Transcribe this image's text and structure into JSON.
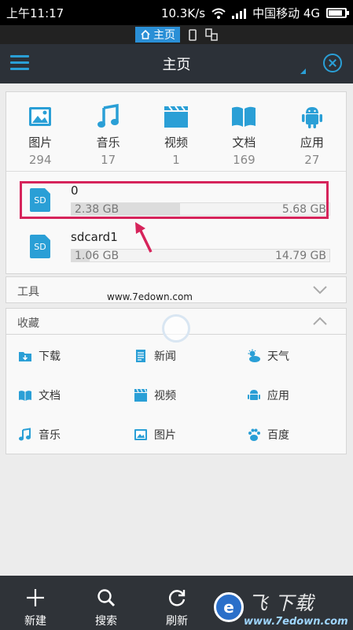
{
  "status_bar": {
    "time": "上午11:17",
    "speed": "10.3K/s",
    "carrier": "中国移动 4G"
  },
  "subbar": {
    "home_tab": "主页"
  },
  "header": {
    "title": "主页"
  },
  "categories": [
    {
      "label": "图片",
      "count": "294",
      "icon": "image-icon"
    },
    {
      "label": "音乐",
      "count": "17",
      "icon": "music-icon"
    },
    {
      "label": "视频",
      "count": "1",
      "icon": "video-icon"
    },
    {
      "label": "文档",
      "count": "169",
      "icon": "book-icon"
    },
    {
      "label": "应用",
      "count": "27",
      "icon": "android-icon"
    }
  ],
  "storage": [
    {
      "icon_label": "SD",
      "name": "0",
      "used": "2.38 GB",
      "total": "5.68 GB",
      "used_fraction": 0.42
    },
    {
      "icon_label": "SD",
      "name": "sdcard1",
      "used": "1.06 GB",
      "total": "14.79 GB",
      "used_fraction": 0.07
    }
  ],
  "tools": {
    "title": "工具"
  },
  "favorites": {
    "title": "收藏",
    "items": [
      {
        "label": "下载",
        "icon": "download-folder-icon"
      },
      {
        "label": "新闻",
        "icon": "news-icon"
      },
      {
        "label": "天气",
        "icon": "weather-icon"
      },
      {
        "label": "文档",
        "icon": "document-folder-icon"
      },
      {
        "label": "视频",
        "icon": "video-folder-icon"
      },
      {
        "label": "应用",
        "icon": "app-folder-icon"
      },
      {
        "label": "音乐",
        "icon": "music-folder-icon"
      },
      {
        "label": "图片",
        "icon": "picture-folder-icon"
      },
      {
        "label": "百度",
        "icon": "baidu-paw-icon"
      }
    ]
  },
  "watermark": "www.7edown.com",
  "bottom_bar": [
    {
      "label": "新建",
      "icon": "plus-icon"
    },
    {
      "label": "搜索",
      "icon": "search-icon"
    },
    {
      "label": "刷新",
      "icon": "refresh-icon"
    }
  ],
  "colors": {
    "accent": "#2a9fd6",
    "highlight": "#d6245b",
    "toolbar": "#2c3138"
  }
}
